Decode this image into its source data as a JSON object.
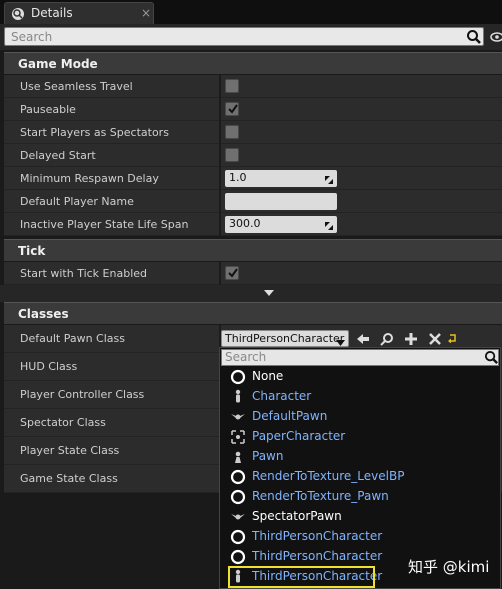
{
  "tab": {
    "title": "Details",
    "close": "×"
  },
  "search": {
    "placeholder": "Search"
  },
  "categories": {
    "game_mode": "Game Mode",
    "tick": "Tick",
    "classes": "Classes"
  },
  "game_mode_rows": [
    {
      "label": "Use Seamless Travel",
      "type": "checkbox",
      "checked": false
    },
    {
      "label": "Pauseable",
      "type": "checkbox",
      "checked": true
    },
    {
      "label": "Start Players as Spectators",
      "type": "checkbox",
      "checked": false
    },
    {
      "label": "Delayed Start",
      "type": "checkbox",
      "checked": false
    },
    {
      "label": "Minimum Respawn Delay",
      "type": "number",
      "value": "1.0"
    },
    {
      "label": "Default Player Name",
      "type": "text",
      "value": ""
    },
    {
      "label": "Inactive Player State Life Span",
      "type": "number",
      "value": "300.0"
    }
  ],
  "tick_rows": [
    {
      "label": "Start with Tick Enabled",
      "type": "checkbox",
      "checked": true
    }
  ],
  "class_rows": [
    "Default Pawn Class",
    "HUD Class",
    "Player Controller Class",
    "Spectator Class",
    "Player State Class",
    "Game State Class"
  ],
  "pawn_combo": {
    "value": "ThirdPersonCharacter"
  },
  "dropdown": {
    "search_placeholder": "Search",
    "items": [
      {
        "label": "None",
        "icon": "circle-icon",
        "color": "#ffffff"
      },
      {
        "label": "Character",
        "icon": "character-icon",
        "color": "#7fb4ff"
      },
      {
        "label": "DefaultPawn",
        "icon": "pawn-wings-icon",
        "color": "#7fb4ff"
      },
      {
        "label": "PaperCharacter",
        "icon": "paper-icon",
        "color": "#7fb4ff"
      },
      {
        "label": "Pawn",
        "icon": "pawn-icon",
        "color": "#7fb4ff"
      },
      {
        "label": "RenderToTexture_LevelBP",
        "icon": "circle-icon",
        "color": "#7fb4ff"
      },
      {
        "label": "RenderToTexture_Pawn",
        "icon": "circle-icon",
        "color": "#7fb4ff"
      },
      {
        "label": "SpectatorPawn",
        "icon": "pawn-wings-icon",
        "color": "#ffffff"
      },
      {
        "label": "ThirdPersonCharacter",
        "icon": "circle-icon",
        "color": "#7fb4ff"
      },
      {
        "label": "ThirdPersonCharacter",
        "icon": "circle-icon",
        "color": "#7fb4ff"
      },
      {
        "label": "ThirdPersonCharacter",
        "icon": "character-icon",
        "color": "#7fb4ff"
      }
    ]
  },
  "watermark": "知乎 @kimi",
  "colors": {
    "highlight": "#f0e030",
    "link": "#7fb4ff"
  }
}
